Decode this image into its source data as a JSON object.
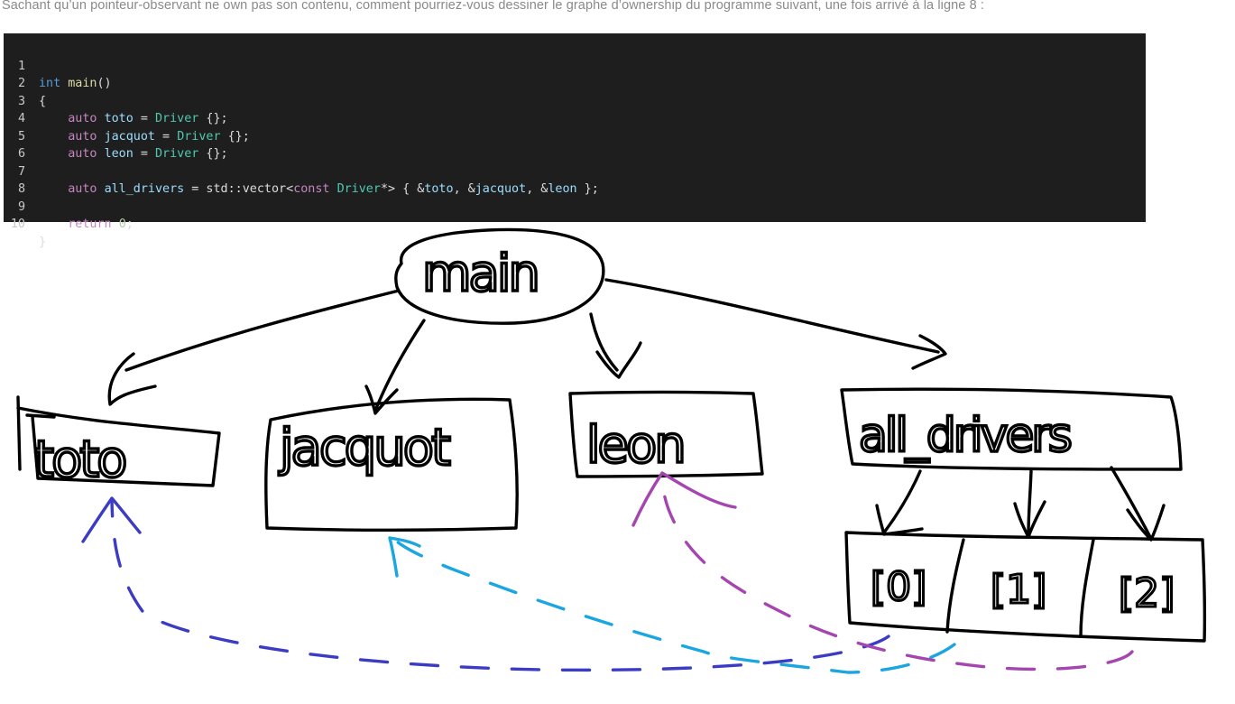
{
  "intro_text": "Sachant qu’un pointeur-observant ne own pas son contenu, comment pourriez-vous dessiner le graphe d’ownership du programme suivant, une fois arrivé à la ligne 8 :",
  "code": {
    "line_numbers": [
      "1",
      "2",
      "3",
      "4",
      "5",
      "6",
      "7",
      "8",
      "9",
      "10"
    ],
    "l1": {
      "type": "int",
      "name": "main",
      "rest": "()"
    },
    "l2": "{",
    "l3": {
      "kw": "auto",
      "var": "toto",
      "eq": " = ",
      "cls": "Driver",
      "rest": " {};"
    },
    "l4": {
      "kw": "auto",
      "var": "jacquot",
      "eq": " = ",
      "cls": "Driver",
      "rest": " {};"
    },
    "l5": {
      "kw": "auto",
      "var": "leon",
      "eq": " = ",
      "cls": "Driver",
      "rest": " {};"
    },
    "l7": {
      "kw": "auto",
      "var": "all_drivers",
      "eq": " = std::vector<",
      "kw2": "const",
      "cls": "Driver",
      "rest1": "*> { &",
      "a": "toto",
      "c1": ", &",
      "b": "jacquot",
      "c2": ", &",
      "c": "leon",
      "rest2": " };"
    },
    "l9": {
      "kw": "return",
      "num": "0",
      "rest": ";"
    },
    "l10": "}"
  },
  "diagram": {
    "root": "main",
    "nodes": [
      "toto",
      "jacquot",
      "leon",
      "all_drivers"
    ],
    "slots": [
      "[0]",
      "[1]",
      "[2]"
    ],
    "colors": {
      "ink": "#000000",
      "toto_ptr": "#3b3bc4",
      "jacquot_ptr": "#1aa6e0",
      "leon_ptr": "#a546b0"
    }
  }
}
